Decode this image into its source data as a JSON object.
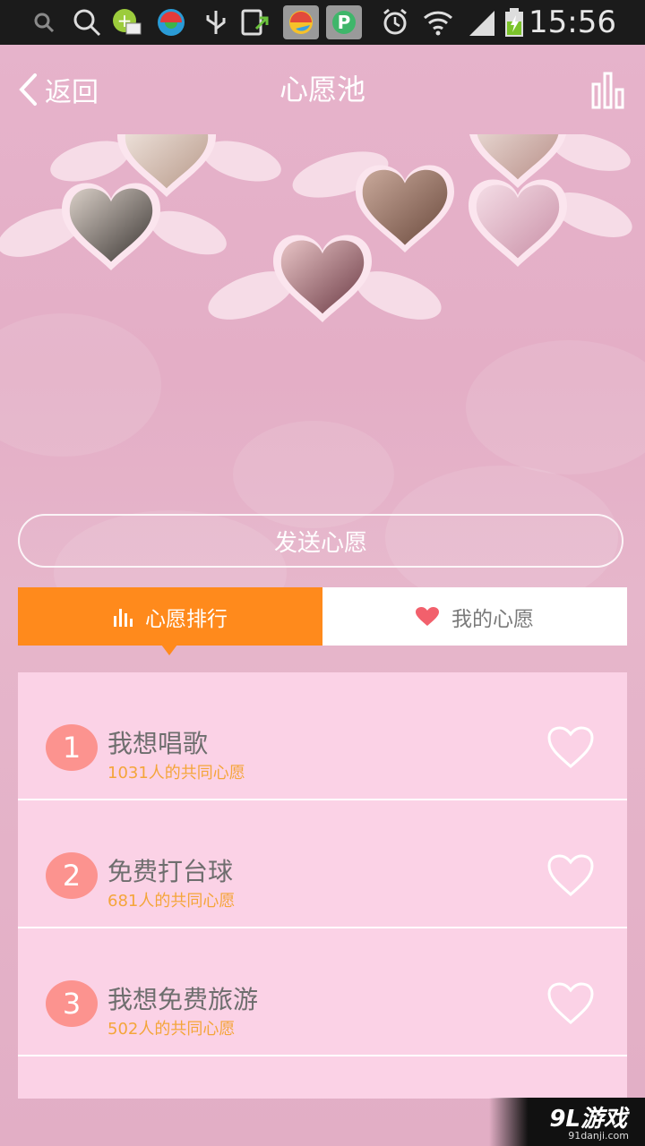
{
  "status_bar": {
    "time": "15:56",
    "icons": [
      "search-icon",
      "search-icon",
      "email-app-icon",
      "sync-app-icon",
      "usb-icon",
      "install-icon",
      "browser-icon",
      "p-app-icon",
      "alarm-icon",
      "wifi-icon",
      "signal-icon",
      "battery-charging-icon"
    ]
  },
  "header": {
    "back_label": "返回",
    "title": "心愿池",
    "right_icon": "ranking-chart-icon"
  },
  "hero": {
    "images": [
      "bride-photo",
      "cat-photo",
      "woman-portrait-photo",
      "bride-portrait-photo",
      "flower-bouquet-photo",
      "girl-selfie-photo"
    ]
  },
  "send_button": "发送心愿",
  "tabs": [
    {
      "label": "心愿排行",
      "icon": "bar-chart-icon",
      "active": true
    },
    {
      "label": "我的心愿",
      "icon": "heart-icon",
      "active": false
    }
  ],
  "wishes": [
    {
      "rank": "1",
      "text": "我想唱歌",
      "count": "1031人的共同心愿"
    },
    {
      "rank": "2",
      "text": "免费打台球",
      "count": "681人的共同心愿"
    },
    {
      "rank": "3",
      "text": "我想免费旅游",
      "count": "502人的共同心愿"
    }
  ],
  "watermark": {
    "logo": "9L游戏",
    "url": "91danji.com"
  },
  "colors": {
    "accent": "#ff8a1c",
    "rank_badge": "#fc938f",
    "count_text": "#f4a53a",
    "list_bg": "#fbd2e6"
  }
}
